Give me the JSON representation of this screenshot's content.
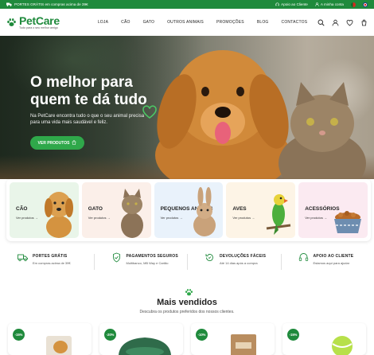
{
  "topbar": {
    "shipping": "PORTES GRÁTIS em compras acima de 39€",
    "support": "Apoio ao Cliente",
    "account": "A minha conta"
  },
  "brand": {
    "name": "PetCare",
    "tagline": "Tudo para o seu melhor amigo",
    "color": "#1f8a3c"
  },
  "nav": [
    "LOJA",
    "CÃO",
    "GATO",
    "OUTROS ANIMAIS",
    "PROMOÇÕES",
    "BLOG",
    "CONTACTOS"
  ],
  "header_icons": [
    "search-icon",
    "user-icon",
    "heart-icon",
    "cart-icon"
  ],
  "hero": {
    "title": "O melhor para quem te dá tudo",
    "subtitle": "Na PetCare encontra tudo o que o seu animal precisa para uma vida mais saudável e feliz.",
    "cta": "VER PRODUTOS"
  },
  "categories": [
    {
      "name": "CÃO",
      "link": "Ver produtos →",
      "bg": "#e9f5e9"
    },
    {
      "name": "GATO",
      "link": "Ver produtos →",
      "bg": "#fbefe9"
    },
    {
      "name": "PEQUENOS ANIMAIS",
      "link": "Ver produtos →",
      "bg": "#e9f2fb"
    },
    {
      "name": "AVES",
      "link": "Ver produtos →",
      "bg": "#fdf4e6"
    },
    {
      "name": "ACESSÓRIOS",
      "link": "Ver produtos →",
      "bg": "#fbeaf1"
    }
  ],
  "features": [
    {
      "title": "PORTES GRÁTIS",
      "desc": "Em compras acima de 39€",
      "icon": "truck-icon"
    },
    {
      "title": "PAGAMENTOS SEGUROS",
      "desc": "Multibanco, MB Way e Cartão",
      "icon": "shield-check-icon"
    },
    {
      "title": "DEVOLUÇÕES FÁCEIS",
      "desc": "Até 14 dias após a compra",
      "icon": "return-icon"
    },
    {
      "title": "APOIO AO CLIENTE",
      "desc": "Estamos aqui para ajudar",
      "icon": "headset-icon"
    }
  ],
  "bestsellers": {
    "title": "Mais vendidos",
    "subtitle": "Descubra os produtos preferidos dos nossos clientes."
  },
  "products": [
    {
      "badge": "-15%"
    },
    {
      "badge": "-20%"
    },
    {
      "badge": "-10%"
    },
    {
      "badge": "-15%"
    }
  ]
}
